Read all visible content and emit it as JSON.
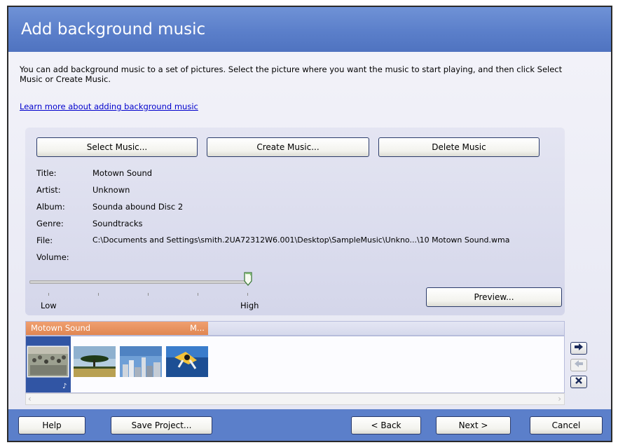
{
  "header": {
    "title": "Add background music"
  },
  "description": "You can add background music to a set of pictures.  Select the picture where you want the music to start playing, and then click Select Music or Create Music.",
  "learn_link": "Learn more about adding background music",
  "actions": {
    "select": "Select Music...",
    "create": "Create Music...",
    "delete": "Delete Music"
  },
  "info": {
    "title_label": "Title:",
    "title_value": "Motown Sound",
    "artist_label": "Artist:",
    "artist_value": "Unknown",
    "album_label": "Album:",
    "album_value": "Sounda abound Disc 2",
    "genre_label": "Genre:",
    "genre_value": "Soundtracks",
    "file_label": "File:",
    "file_value": "C:\\Documents and Settings\\smith.2UA72312W6.001\\Desktop\\SampleMusic\\Unkno...\\10 Motown Sound.wma",
    "volume_label": "Volume:"
  },
  "volume": {
    "low_label": "Low",
    "high_label": "High",
    "level": 1.0
  },
  "preview_button": "Preview...",
  "timeline": {
    "music_title": "Motown Sound",
    "music_suffix": "M..."
  },
  "thumbnails": [
    "orchestra",
    "savanna-tree",
    "city-skyline",
    "skydiver"
  ],
  "footer": {
    "help": "Help",
    "save": "Save Project...",
    "back": "< Back",
    "next": "Next >",
    "cancel": "Cancel"
  },
  "colors": {
    "header_blue": "#5b7fca",
    "music_orange": "#e08652",
    "selected_blue": "#3155a4"
  }
}
